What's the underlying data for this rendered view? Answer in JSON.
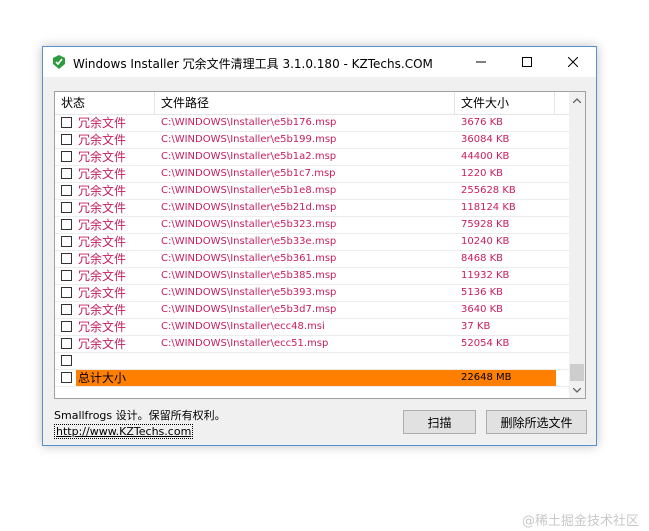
{
  "window": {
    "title": "Windows Installer 冗余文件清理工具 3.1.0.180 - KZTechs.COM"
  },
  "table": {
    "columns": [
      "状态",
      "文件路径",
      "文件大小"
    ],
    "rows": [
      {
        "status": "冗余文件",
        "path": "C:\\WINDOWS\\Installer\\e5b176.msp",
        "size": "3676 KB"
      },
      {
        "status": "冗余文件",
        "path": "C:\\WINDOWS\\Installer\\e5b199.msp",
        "size": "36084 KB"
      },
      {
        "status": "冗余文件",
        "path": "C:\\WINDOWS\\Installer\\e5b1a2.msp",
        "size": "44400 KB"
      },
      {
        "status": "冗余文件",
        "path": "C:\\WINDOWS\\Installer\\e5b1c7.msp",
        "size": "1220 KB"
      },
      {
        "status": "冗余文件",
        "path": "C:\\WINDOWS\\Installer\\e5b1e8.msp",
        "size": "255628 KB"
      },
      {
        "status": "冗余文件",
        "path": "C:\\WINDOWS\\Installer\\e5b21d.msp",
        "size": "118124 KB"
      },
      {
        "status": "冗余文件",
        "path": "C:\\WINDOWS\\Installer\\e5b323.msp",
        "size": "75928 KB"
      },
      {
        "status": "冗余文件",
        "path": "C:\\WINDOWS\\Installer\\e5b33e.msp",
        "size": "10240 KB"
      },
      {
        "status": "冗余文件",
        "path": "C:\\WINDOWS\\Installer\\e5b361.msp",
        "size": "8468 KB"
      },
      {
        "status": "冗余文件",
        "path": "C:\\WINDOWS\\Installer\\e5b385.msp",
        "size": "11932 KB"
      },
      {
        "status": "冗余文件",
        "path": "C:\\WINDOWS\\Installer\\e5b393.msp",
        "size": "5136 KB"
      },
      {
        "status": "冗余文件",
        "path": "C:\\WINDOWS\\Installer\\e5b3d7.msp",
        "size": "3640 KB"
      },
      {
        "status": "冗余文件",
        "path": "C:\\WINDOWS\\Installer\\ecc48.msi",
        "size": "37 KB"
      },
      {
        "status": "冗余文件",
        "path": "C:\\WINDOWS\\Installer\\ecc51.msp",
        "size": "52054 KB"
      },
      {
        "status": "",
        "path": "",
        "size": ""
      }
    ],
    "total": {
      "status": "总计大小",
      "path": "",
      "size": "22648 MB"
    }
  },
  "footer": {
    "copyright": "Smallfrogs 设计。保留所有权利。",
    "link": "http://www.KZTechs.com"
  },
  "buttons": {
    "scan": "扫描",
    "delete": "删除所选文件"
  },
  "watermark": "@稀土掘金技术社区",
  "colors": {
    "redundant_text": "#c81d5e",
    "total_highlight": "#ff8000",
    "window_border": "#5a8fd0"
  },
  "icons": [
    "app-icon",
    "minimize-icon",
    "maximize-icon",
    "close-icon",
    "scroll-up-icon",
    "scroll-down-icon"
  ]
}
